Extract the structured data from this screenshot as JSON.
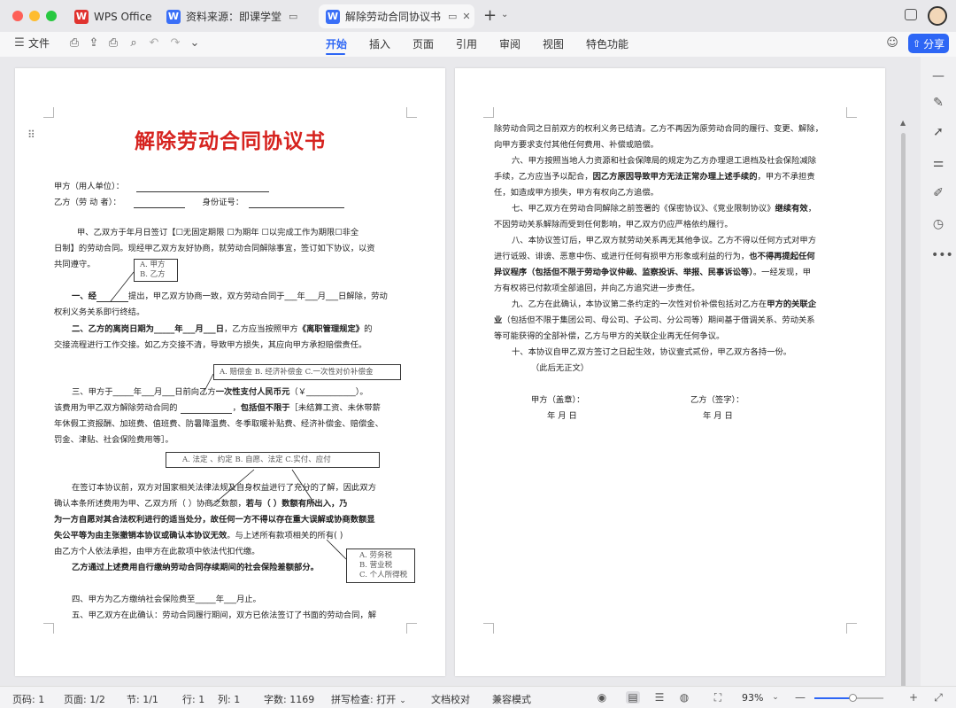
{
  "tabs": [
    {
      "label": "WPS Office"
    },
    {
      "label": "资料来源：即课学堂"
    },
    {
      "label": "解除劳动合同协议书"
    }
  ],
  "toolbar": {
    "file_label": "文件",
    "menu_tabs": [
      "开始",
      "插入",
      "页面",
      "引用",
      "审阅",
      "视图",
      "特色功能"
    ],
    "share_label": "分享"
  },
  "document": {
    "title": "解除劳动合同协议书",
    "page1_lines": [
      "甲方（用人单位）：",
      "乙方（劳 动 者）：",
      "身份证号：",
      "甲、乙双方于年月日签订【☐无固定期限   ☐为期年   ☐以完成工作为期限☐非全",
      "日制】的劳动合同。现经甲乙双方友好协商，就劳动合同解除事宜，签订如下协议，以资",
      "共同遵守。",
      "一、经",
      "提出，甲乙双方协商一致，双方劳动合同于___年___月___日解除，劳动",
      "权利义务关系即行终结。",
      "二、乙方的离岗日期为_____年___月___日",
      "，乙方应当按照甲方",
      "《离职管理规定》",
      "的",
      "交接流程进行工作交接。如乙方交接不清，导致甲方损失，其应向甲方承担赔偿责任。",
      "三、甲方于_____年___月___日前向乙方",
      "一次性支付人民币元",
      "（￥____________）。",
      "该费用为甲乙双方解除劳动合同的",
      "，",
      "包括但不限于",
      "［未结算工资、未休带薪",
      "年休假工资报酬、加班费、值班费、防暑降温费、冬季取暖补贴费、经济补偿金、赔偿金、",
      "罚金、津贴、社会保险费用等］。",
      "在签订本协议前，双方对国家相关法律法规及自身权益进行了充分的了解，因此双方",
      "确认本条所述费用为甲、乙双方所（       ）协商之数额，",
      "若与（       ）数额有所出入，乃",
      "为一方自愿对其合法权利进行的适当处分，故任何一方不得以存在重大误解或协商数额显",
      "失公平等为由主张撤销本协议或确认本协议无效",
      "。与上述所有款项相关的所有(          )",
      "由乙方个人依法承担，由甲方在此款项中依法代扣代缴。",
      "乙方通过上述费用自行缴纳劳动合同存续期间的社会保险差额部分。",
      "四、甲方为乙方缴纳社会保险费至_____年___月止。",
      "五、甲乙双方在此确认：劳动合同履行期间，双方已依法签订了书面的劳动合同，解"
    ],
    "annotations": {
      "party": [
        "A.  甲方",
        "B.  乙方"
      ],
      "compensation": "A.  赔偿金    B.  经济补偿金    C.一次性对价补偿金",
      "basis": "A.  法定 、约定      B.  自愿、法定        C.实付、应付",
      "tax": [
        "A.  劳务税",
        "B.  营业税",
        "C.  个人所得税"
      ]
    },
    "page2_lines": [
      "除劳动合同之日前双方的权利义务已结清。乙方不再因为原劳动合同的履行、变更、解除，",
      "向甲方要求支付其他任何费用、补偿或赔偿。",
      "六、甲方按照当地人力资源和社会保障局的规定为乙方办理退工退档及社会保险减除",
      "手续，乙方应当予以配合，",
      "因乙方原因导致甲方无法正常办理上述手续的",
      "，甲方不承担责",
      "任，如造成甲方损失，甲方有权向乙方追偿。",
      "七、甲乙双方在劳动合同解除之前签署的《保密协议》、《竞业限制协议》",
      "继续有效",
      "，",
      "不因劳动关系解除而受到任何影响，甲乙双方仍应严格依约履行。",
      "八、本协议签订后，甲乙双方就劳动关系再无其他争议。乙方不得以任何方式对甲方",
      "进行诋毁、诽谤、恶意中伤、或进行任何有损甲方形象或利益的行为，",
      "也不得再提起任何",
      "异议程序（包括但不限于劳动争议仲裁、监察投诉、举报、民事诉讼等）",
      "。一经发现，甲",
      "方有权将已付款项全部追回，并向乙方追究进一步责任。",
      "九、乙方在此确认，本协议第二条约定的一次性对价补偿包括对乙方在",
      "甲方的关联企",
      "业",
      "（包括但不限于集团公司、母公司、子公司、分公司等）期间基于借调关系、劳动关系",
      "等可能获得的全部补偿，乙方与甲方的关联企业再无任何争议。",
      "十、本协议自甲乙双方签订之日起生效，协议壹式贰份，甲乙双方各持一份。",
      "（此后无正文）",
      "甲方（盖章）：",
      "乙方（签字）：",
      "年    月    日",
      "年    月    日"
    ]
  },
  "statusbar": {
    "page_code": "页码: 1",
    "page_count": "页面: 1/2",
    "section": "节: 1/1",
    "row": "行: 1",
    "col": "列: 1",
    "word_count": "字数: 1169",
    "spell_check": "拼写检查: 打开",
    "proofread": "文档校对",
    "compat": "兼容模式",
    "zoom": "93%",
    "zoom_fraction": 0.55
  },
  "colors": {
    "accent": "#2d66f5",
    "title_red": "#d6231f"
  }
}
